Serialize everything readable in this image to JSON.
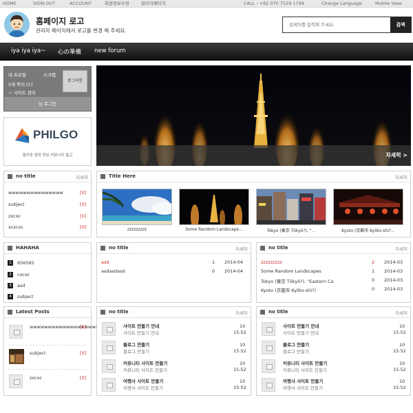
{
  "topbar": {
    "home": "HOME",
    "signout": "SIGN-OUT",
    "account": "ACCOUNT",
    "link4": "회원정보수정",
    "link5": "관리자페이지",
    "call": "CALL : +82 070 7529 1749",
    "change_language": "Change Language",
    "mobile_view": "Mobile View"
  },
  "header": {
    "title": "홈페이지 로고",
    "subtitle": "관리자 페이지에서 로고를 변경 해 주세요."
  },
  "search": {
    "placeholder": "검색어를 입력해 주세요.",
    "button": "검색"
  },
  "nav": {
    "items": [
      "iya iya iya~",
      "心の準備",
      "new forum"
    ]
  },
  "login": {
    "line1_a": "내 프로필",
    "line1_b": "스크랩",
    "line2": "5개 쪽지 [1]",
    "line3": "☆ 사이트 관리",
    "logout": "로그아웃",
    "bottom": "님 로그인"
  },
  "philgo": {
    "logo_text": "PHILGO",
    "tagline": "필리핀 생대 정보 커뮤니티 필고"
  },
  "banner": {
    "more": "자세히 >"
  },
  "box_notitle1": {
    "title": "no title",
    "more": "자세히",
    "rows": [
      {
        "text": "wwwwwwwwwwwwwww",
        "count": "[0]"
      },
      {
        "text": "subject",
        "count": "[0]"
      },
      {
        "text": "zxcxc",
        "count": "[0]"
      },
      {
        "text": "xcxcxc",
        "count": "[0]"
      }
    ]
  },
  "gallery": {
    "title": "Title Here",
    "more": "자세히",
    "captions": [
      "zzzzzzzzz",
      "Some Random Landscape...",
      "Tokyo (東京 Tōkyō?), \"...",
      "Kyoto (京都市 Kyōto-shi?..."
    ]
  },
  "hahaha": {
    "title": "HAHAHA",
    "items": [
      {
        "num": "1",
        "text": "656565"
      },
      {
        "num": "2",
        "text": "cxcxc"
      },
      {
        "num": "3",
        "text": "asd"
      },
      {
        "num": "4",
        "text": "subject"
      }
    ]
  },
  "box_mid1": {
    "title": "no title",
    "more": "자세히",
    "rows": [
      {
        "text": "asd",
        "count": "1",
        "date": "2014-04"
      },
      {
        "text": "asdasdasd",
        "count": "0",
        "date": "2014-04"
      }
    ]
  },
  "box_right1": {
    "title": "no title",
    "more": "자세히",
    "rows": [
      {
        "text": "zzzzzzzzz",
        "count": "2",
        "date": "2014-03"
      },
      {
        "text": "Some Random Landscapes",
        "count": "1",
        "date": "2014-03"
      },
      {
        "text": "Tokyo (東京 Tōkyō?), \"Eastern Ca",
        "count": "0",
        "date": "2014-03"
      },
      {
        "text": "Kyoto (京都市 Kyōto-shi?)",
        "count": "0",
        "date": "2014-03"
      }
    ]
  },
  "latest": {
    "title": "Latest Posts",
    "rows": [
      {
        "text": "wwwwwwwwwwwwwwwwwww",
        "count": "[0]"
      },
      {
        "text": "subject",
        "count": "[0]"
      },
      {
        "text": "zxcxc",
        "count": "[0]"
      }
    ]
  },
  "box_mid2": {
    "title": "no title",
    "more": "자세히",
    "rows": [
      {
        "title": "사이트 만들기 안내",
        "sub": "사이트 만들기 안내",
        "n": "10",
        "time": "15:52"
      },
      {
        "title": "블로그 만들기",
        "sub": "블로그 만들기",
        "n": "10",
        "time": "15:52"
      },
      {
        "title": "커뮤니티 사이트 만들기",
        "sub": "커뮤니티 사이트 만들기",
        "n": "10",
        "time": "15:52"
      },
      {
        "title": "여행사 사이트 만들기",
        "sub": "여행사 사이트 만들기",
        "n": "10",
        "time": "15:52"
      }
    ]
  },
  "box_right2": {
    "title": "no title",
    "more": "자세히",
    "rows": [
      {
        "title": "사이트 만들기 안내",
        "sub": "사이트 만들기 안내",
        "n": "10",
        "time": "15:52"
      },
      {
        "title": "블로그 만들기",
        "sub": "블로그 만들기",
        "n": "10",
        "time": "15:52"
      },
      {
        "title": "커뮤니티 사이트 만들기",
        "sub": "커뮤니티 사이트 만들기",
        "n": "10",
        "time": "15:52"
      },
      {
        "title": "여행사 사이트 만들기",
        "sub": "여행사 사이트 만들기",
        "n": "10",
        "time": "15:52"
      }
    ]
  }
}
